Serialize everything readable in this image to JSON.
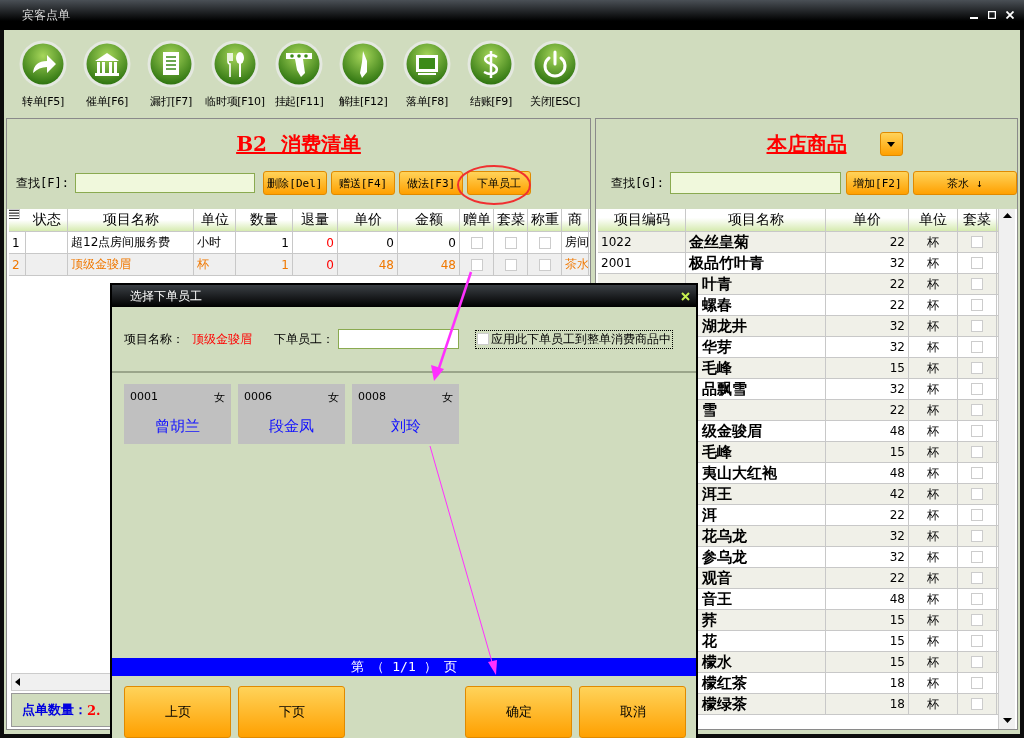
{
  "window": {
    "title": "宾客点单"
  },
  "toolbar": [
    {
      "label": "转单[F5]",
      "kind": "forward"
    },
    {
      "label": "催单[F6]",
      "kind": "bank"
    },
    {
      "label": "漏打[F7]",
      "kind": "document"
    },
    {
      "label": "临时项[F10]",
      "kind": "utensils"
    },
    {
      "label": "挂起[F11]",
      "kind": "hang"
    },
    {
      "label": "解挂[F12]",
      "kind": "unhang"
    },
    {
      "label": "落单[F8]",
      "kind": "screen"
    },
    {
      "label": "结账[F9]",
      "kind": "dollar"
    },
    {
      "label": "关闭[ESC]",
      "kind": "power"
    }
  ],
  "order_panel": {
    "title": "B2  消费清单",
    "search_label": "查找[F]:",
    "buttons": [
      "删除[Del]",
      "赠送[F4]",
      "做法[F3]",
      "下单员工"
    ],
    "columns": [
      "状态",
      "项目名称",
      "单位",
      "数量",
      "退量",
      "单价",
      "金额",
      "赠单",
      "套菜",
      "称重",
      "商"
    ],
    "rows": [
      {
        "index": "1",
        "name": "超12点房间服务费",
        "unit": "小时",
        "qty": "1",
        "returned": "0",
        "price": "0",
        "amount": "0",
        "gift": false,
        "set": false,
        "weigh": false,
        "category": "房间",
        "selected": false
      },
      {
        "index": "2",
        "name": "顶级金骏眉",
        "unit": "杯",
        "qty": "1",
        "returned": "0",
        "price": "48",
        "amount": "48",
        "gift": false,
        "set": false,
        "weigh": false,
        "category": "茶水",
        "selected": true
      }
    ],
    "status_label": "点单数量：",
    "status_value": "2."
  },
  "product_panel": {
    "title": "本店商品",
    "search_label": "查找[G]:",
    "add_button": "增加[F2]",
    "category_button": "茶水 ↓",
    "columns": [
      "项目编码",
      "项目名称",
      "单价",
      "单位",
      "套菜"
    ],
    "rows": [
      {
        "code": "1022",
        "name": "金丝皇菊",
        "price": "22",
        "unit": "杯",
        "checked": false
      },
      {
        "code": "2001",
        "name": "极品竹叶青",
        "price": "32",
        "unit": "杯",
        "checked": false
      },
      {
        "name": "叶青",
        "price": "22",
        "unit": "杯",
        "checked": false
      },
      {
        "name": "螺春",
        "price": "22",
        "unit": "杯",
        "checked": false
      },
      {
        "name": "湖龙井",
        "price": "32",
        "unit": "杯",
        "checked": false
      },
      {
        "name": "华芽",
        "price": "32",
        "unit": "杯",
        "checked": false
      },
      {
        "name": "毛峰",
        "price": "15",
        "unit": "杯",
        "checked": false
      },
      {
        "name": "品飘雪",
        "price": "32",
        "unit": "杯",
        "checked": false
      },
      {
        "name": "雪",
        "price": "22",
        "unit": "杯",
        "checked": false
      },
      {
        "name": "级金骏眉",
        "price": "48",
        "unit": "杯",
        "checked": false
      },
      {
        "name": "毛峰",
        "price": "15",
        "unit": "杯",
        "checked": false
      },
      {
        "name": "夷山大红袍",
        "price": "48",
        "unit": "杯",
        "checked": false
      },
      {
        "name": "洱王",
        "price": "42",
        "unit": "杯",
        "checked": false
      },
      {
        "name": "洱",
        "price": "22",
        "unit": "杯",
        "checked": false
      },
      {
        "name": "花乌龙",
        "price": "32",
        "unit": "杯",
        "checked": false
      },
      {
        "name": "参乌龙",
        "price": "32",
        "unit": "杯",
        "checked": false
      },
      {
        "name": "观音",
        "price": "22",
        "unit": "杯",
        "checked": false
      },
      {
        "name": "音王",
        "price": "48",
        "unit": "杯",
        "checked": false
      },
      {
        "name": "荞",
        "price": "15",
        "unit": "杯",
        "checked": false
      },
      {
        "name": "花",
        "price": "15",
        "unit": "杯",
        "checked": false
      },
      {
        "name": "檬水",
        "price": "15",
        "unit": "杯",
        "checked": false
      },
      {
        "name": "檬红茶",
        "price": "18",
        "unit": "杯",
        "checked": false
      },
      {
        "name": "檬绿茶",
        "price": "18",
        "unit": "杯",
        "checked": false
      }
    ]
  },
  "dialog": {
    "title": "选择下单员工",
    "item_label": "项目名称：",
    "item_value": "顶级金骏眉",
    "staff_label": "下单员工：",
    "apply": {
      "label": "应用此下单员工到整单消费商品中",
      "checked": false
    },
    "staff": [
      {
        "code": "0001",
        "gender": "女",
        "name": "曾胡兰"
      },
      {
        "code": "0006",
        "gender": "女",
        "name": "段金凤"
      },
      {
        "code": "0008",
        "gender": "女",
        "name": "刘玲"
      }
    ],
    "page": "第 （ 1/1 ） 页",
    "buttons": [
      "上页",
      "下页",
      "确定",
      "取消"
    ]
  }
}
